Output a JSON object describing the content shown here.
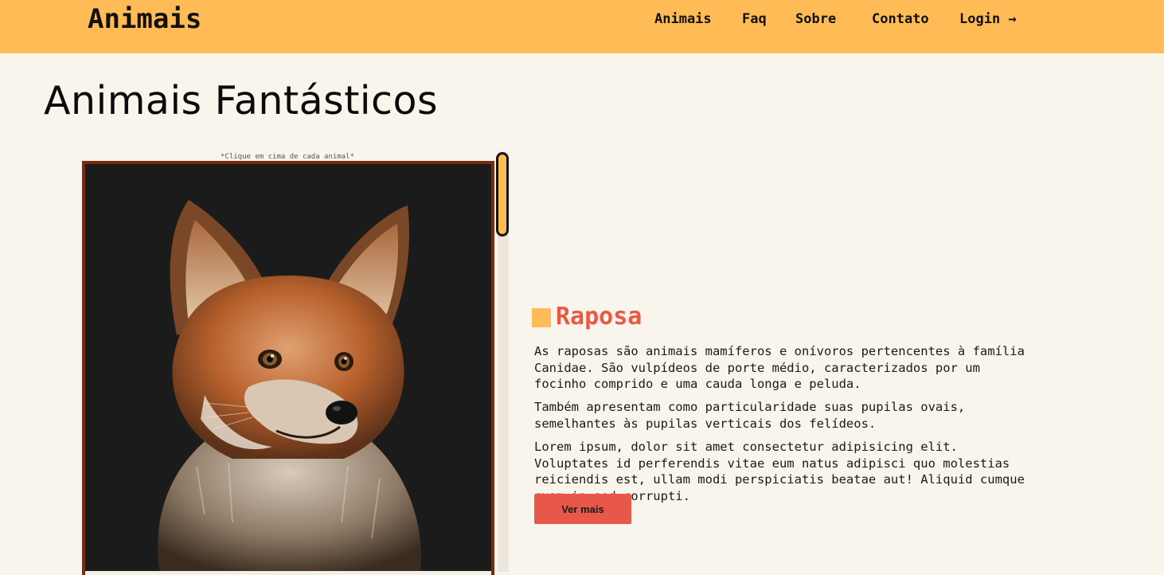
{
  "header": {
    "logo": "Animais",
    "nav": [
      {
        "label": "Animais"
      },
      {
        "label": "Faq"
      },
      {
        "label": "Sobre"
      },
      {
        "label": "Contato"
      },
      {
        "label": "Login →"
      }
    ]
  },
  "main": {
    "title": "Animais Fantásticos",
    "hint": "*Clique em cima de cada animal*",
    "gallery": {
      "image_subject": "Raposa"
    },
    "content": {
      "name": "Raposa",
      "paragraphs": [
        "As raposas são animais mamíferos e onívoros pertencentes à família Canidae. São vulpídeos de porte médio, caracterizados por um focinho comprido e uma cauda longa e peluda.",
        "Também apresentam como particularidade suas pupilas ovais, semelhantes às pupilas verticais dos felídeos.",
        "Lorem ipsum, dolor sit amet consectetur adipisicing elit. Voluptates id perferendis vitae eum natus adipisci quo molestias reiciendis est, ullam modi perspiciatis beatae aut! Aliquid cumque quam in sed corrupti."
      ],
      "button_label": "Ver mais"
    }
  },
  "colors": {
    "header_bg": "#ffbb55",
    "page_bg": "#f9f4ec",
    "accent": "#e85a44",
    "frame": "#7a2a0e"
  }
}
